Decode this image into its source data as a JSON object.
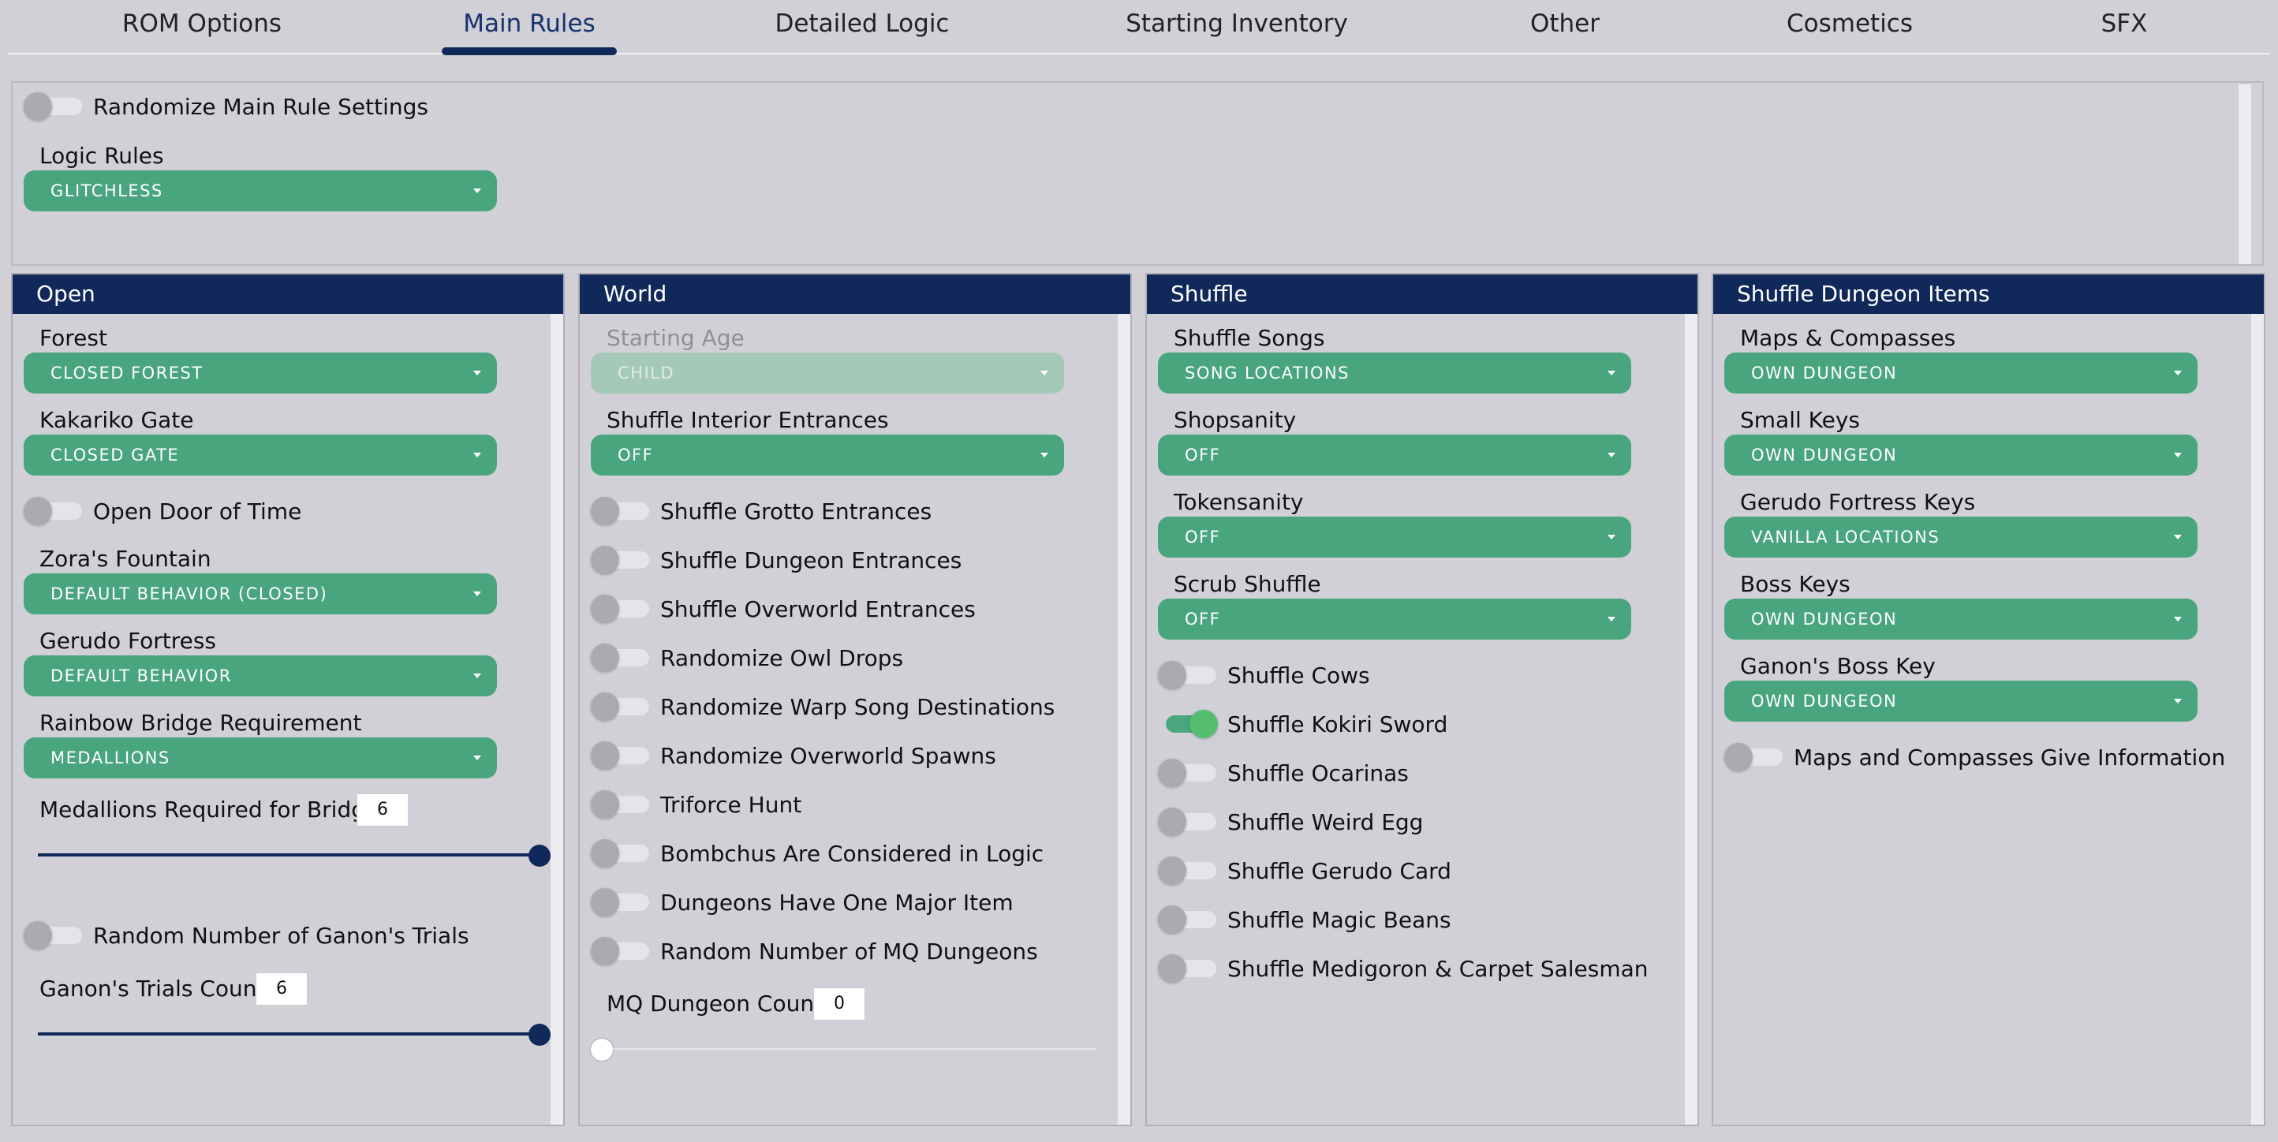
{
  "tabs": [
    {
      "label": "ROM Options"
    },
    {
      "label": "Main Rules"
    },
    {
      "label": "Detailed Logic"
    },
    {
      "label": "Starting Inventory"
    },
    {
      "label": "Other"
    },
    {
      "label": "Cosmetics"
    },
    {
      "label": "SFX"
    }
  ],
  "active_tab": "Main Rules",
  "top": {
    "randomize_label": "Randomize Main Rule Settings",
    "randomize_on": false,
    "logic_rules_label": "Logic Rules",
    "logic_rules_value": "GLITCHLESS"
  },
  "open": {
    "title": "Open",
    "forest_label": "Forest",
    "forest_value": "CLOSED FOREST",
    "kakariko_label": "Kakariko Gate",
    "kakariko_value": "CLOSED GATE",
    "door_of_time_label": "Open Door of Time",
    "zora_label": "Zora's Fountain",
    "zora_value": "DEFAULT BEHAVIOR (CLOSED)",
    "gerudo_label": "Gerudo Fortress",
    "gerudo_value": "DEFAULT BEHAVIOR",
    "bridge_label": "Rainbow Bridge Requirement",
    "bridge_value": "MEDALLIONS",
    "medallions_label": "Medallions Required for Bridge:",
    "medallions_value": "6",
    "medallions_fraction": 1.0,
    "random_trials_label": "Random Number of Ganon's Trials",
    "trials_label": "Ganon's Trials Count:",
    "trials_value": "6",
    "trials_fraction": 1.0
  },
  "world": {
    "title": "World",
    "starting_age_label": "Starting Age",
    "starting_age_value": "CHILD",
    "interior_label": "Shuffle Interior Entrances",
    "interior_value": "OFF",
    "toggles": [
      {
        "label": "Shuffle Grotto Entrances",
        "on": false
      },
      {
        "label": "Shuffle Dungeon Entrances",
        "on": false
      },
      {
        "label": "Shuffle Overworld Entrances",
        "on": false
      },
      {
        "label": "Randomize Owl Drops",
        "on": false
      },
      {
        "label": "Randomize Warp Song Destinations",
        "on": false
      },
      {
        "label": "Randomize Overworld Spawns",
        "on": false
      },
      {
        "label": "Triforce Hunt",
        "on": false
      },
      {
        "label": "Bombchus Are Considered in Logic",
        "on": false
      },
      {
        "label": "Dungeons Have One Major Item",
        "on": false
      },
      {
        "label": "Random Number of MQ Dungeons",
        "on": false
      }
    ],
    "mq_label": "MQ Dungeon Count:",
    "mq_value": "0",
    "mq_fraction": 0.0
  },
  "shuffle": {
    "title": "Shuffle",
    "songs_label": "Shuffle Songs",
    "songs_value": "SONG LOCATIONS",
    "shopsanity_label": "Shopsanity",
    "shopsanity_value": "OFF",
    "tokensanity_label": "Tokensanity",
    "tokensanity_value": "OFF",
    "scrub_label": "Scrub Shuffle",
    "scrub_value": "OFF",
    "toggles": [
      {
        "label": "Shuffle Cows",
        "on": false
      },
      {
        "label": "Shuffle Kokiri Sword",
        "on": true
      },
      {
        "label": "Shuffle Ocarinas",
        "on": false
      },
      {
        "label": "Shuffle Weird Egg",
        "on": false
      },
      {
        "label": "Shuffle Gerudo Card",
        "on": false
      },
      {
        "label": "Shuffle Magic Beans",
        "on": false
      },
      {
        "label": "Shuffle Medigoron & Carpet Salesman",
        "on": false
      }
    ]
  },
  "dungeon_items": {
    "title": "Shuffle Dungeon Items",
    "maps_label": "Maps & Compasses",
    "maps_value": "OWN DUNGEON",
    "small_keys_label": "Small Keys",
    "small_keys_value": "OWN DUNGEON",
    "gerudo_keys_label": "Gerudo Fortress Keys",
    "gerudo_keys_value": "VANILLA LOCATIONS",
    "boss_keys_label": "Boss Keys",
    "boss_keys_value": "OWN DUNGEON",
    "ganon_key_label": "Ganon's Boss Key",
    "ganon_key_value": "OWN DUNGEON",
    "maps_info_label": "Maps and Compasses Give Information",
    "maps_info_on": false
  },
  "colors": {
    "header_navy": "#10295a",
    "select_green": "#49a57d",
    "toggle_on": "#56bd6e",
    "background": "#d0d0d6"
  }
}
